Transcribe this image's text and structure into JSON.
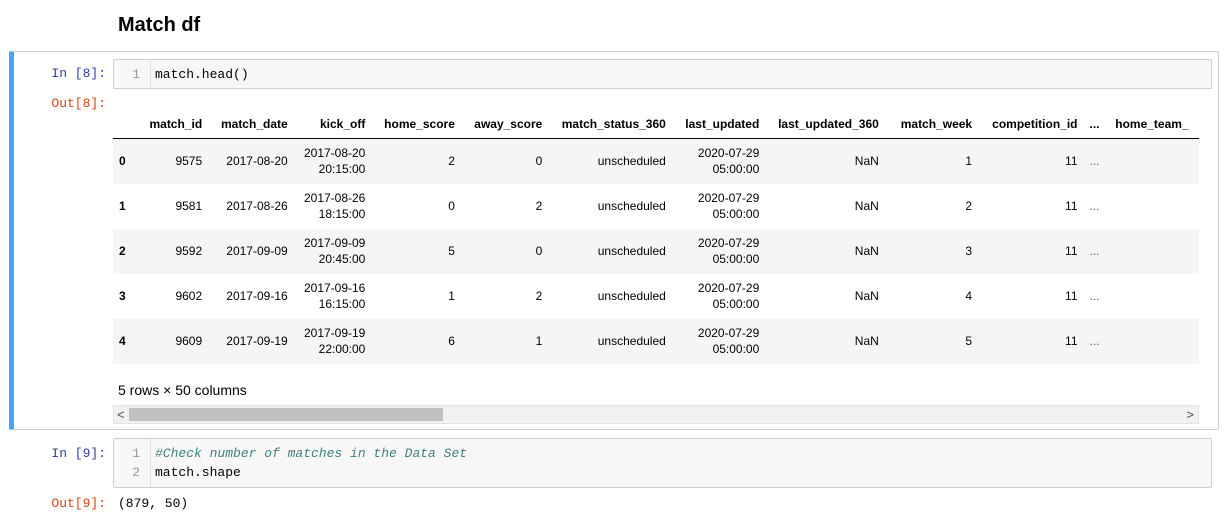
{
  "heading": "Match df",
  "cell1": {
    "in_prompt": "In [8]:",
    "out_prompt": "Out[8]:",
    "lines": [
      {
        "num": "1",
        "code": "match.head()"
      }
    ]
  },
  "dataframe": {
    "index_header": "",
    "columns": [
      "match_id",
      "match_date",
      "kick_off",
      "home_score",
      "away_score",
      "match_status_360",
      "last_updated",
      "last_updated_360",
      "match_week",
      "competition_id",
      "...",
      "home_team_"
    ],
    "rows": [
      {
        "index": "0",
        "match_id": "9575",
        "match_date": "2017-08-20",
        "kick_off": [
          "2017-08-20",
          "20:15:00"
        ],
        "home_score": "2",
        "away_score": "0",
        "match_status_360": "unscheduled",
        "last_updated": [
          "2020-07-29",
          "05:00:00"
        ],
        "last_updated_360": "NaN",
        "match_week": "1",
        "competition_id": "11",
        "ellipsis": "..."
      },
      {
        "index": "1",
        "match_id": "9581",
        "match_date": "2017-08-26",
        "kick_off": [
          "2017-08-26",
          "18:15:00"
        ],
        "home_score": "0",
        "away_score": "2",
        "match_status_360": "unscheduled",
        "last_updated": [
          "2020-07-29",
          "05:00:00"
        ],
        "last_updated_360": "NaN",
        "match_week": "2",
        "competition_id": "11",
        "ellipsis": "..."
      },
      {
        "index": "2",
        "match_id": "9592",
        "match_date": "2017-09-09",
        "kick_off": [
          "2017-09-09",
          "20:45:00"
        ],
        "home_score": "5",
        "away_score": "0",
        "match_status_360": "unscheduled",
        "last_updated": [
          "2020-07-29",
          "05:00:00"
        ],
        "last_updated_360": "NaN",
        "match_week": "3",
        "competition_id": "11",
        "ellipsis": "..."
      },
      {
        "index": "3",
        "match_id": "9602",
        "match_date": "2017-09-16",
        "kick_off": [
          "2017-09-16",
          "16:15:00"
        ],
        "home_score": "1",
        "away_score": "2",
        "match_status_360": "unscheduled",
        "last_updated": [
          "2020-07-29",
          "05:00:00"
        ],
        "last_updated_360": "NaN",
        "match_week": "4",
        "competition_id": "11",
        "ellipsis": "..."
      },
      {
        "index": "4",
        "match_id": "9609",
        "match_date": "2017-09-19",
        "kick_off": [
          "2017-09-19",
          "22:00:00"
        ],
        "home_score": "6",
        "away_score": "1",
        "match_status_360": "unscheduled",
        "last_updated": [
          "2020-07-29",
          "05:00:00"
        ],
        "last_updated_360": "NaN",
        "match_week": "5",
        "competition_id": "11",
        "ellipsis": "..."
      }
    ],
    "summary": "5 rows × 50 columns"
  },
  "scrollbar": {
    "left_arrow": "<",
    "right_arrow": ">"
  },
  "cell2": {
    "in_prompt": "In [9]:",
    "out_prompt": "Out[9]:",
    "lines": [
      {
        "num": "1",
        "code": "#Check number of matches in the Data Set"
      },
      {
        "num": "2",
        "code": "match.shape"
      }
    ],
    "output": "(879, 50)"
  },
  "colors": {
    "accent": "#42a5f5",
    "in_prompt": "#303f9f",
    "out_prompt": "#d84315",
    "comment": "#408080"
  }
}
